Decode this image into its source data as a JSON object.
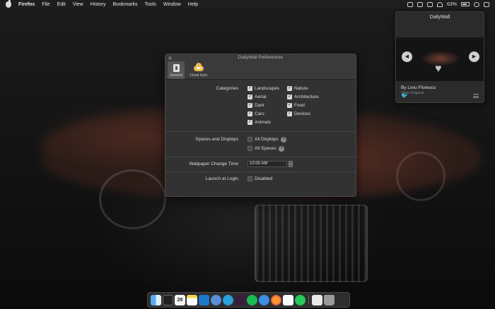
{
  "menubar": {
    "app_name": "Firefox",
    "items": [
      "File",
      "Edit",
      "View",
      "History",
      "Bookmarks",
      "Tools",
      "Window",
      "Help"
    ],
    "battery_percent": "63%"
  },
  "widget": {
    "title": "DailyWall",
    "author": "By Liviu Florescu",
    "view_original": "View Original"
  },
  "prefs": {
    "title": "DailyWall Preferences",
    "tabs": [
      {
        "label": "General",
        "icon": "general-icon",
        "active": true
      },
      {
        "label": "Cloud Sync",
        "icon": "cloud-icon",
        "active": false
      }
    ],
    "categories": {
      "label": "Categories",
      "items": [
        {
          "label": "Landscapes",
          "checked": true
        },
        {
          "label": "Nature",
          "checked": true
        },
        {
          "label": "Aerial",
          "checked": true
        },
        {
          "label": "Architecture",
          "checked": true
        },
        {
          "label": "Dark",
          "checked": true
        },
        {
          "label": "Food",
          "checked": true
        },
        {
          "label": "Cars",
          "checked": true
        },
        {
          "label": "Devices",
          "checked": true
        },
        {
          "label": "Animals",
          "checked": true
        }
      ]
    },
    "spaces": {
      "label": "Spaces and Displays",
      "all_displays": "All Displays",
      "all_spaces": "All Spaces"
    },
    "wallpaper_time": {
      "label": "Wallpaper Change Time",
      "value": "10:00 AM"
    },
    "launch": {
      "label": "Launch at Login",
      "option": "Disabled"
    }
  },
  "dock": {
    "icons": [
      "finder",
      "terminal",
      "calendar",
      "notes",
      "vscode",
      "browser",
      "telegram",
      "slack",
      "spotify",
      "safari",
      "firefox",
      "slack-2",
      "whatsapp",
      "preview",
      "trash"
    ],
    "calendar_day": "29"
  }
}
